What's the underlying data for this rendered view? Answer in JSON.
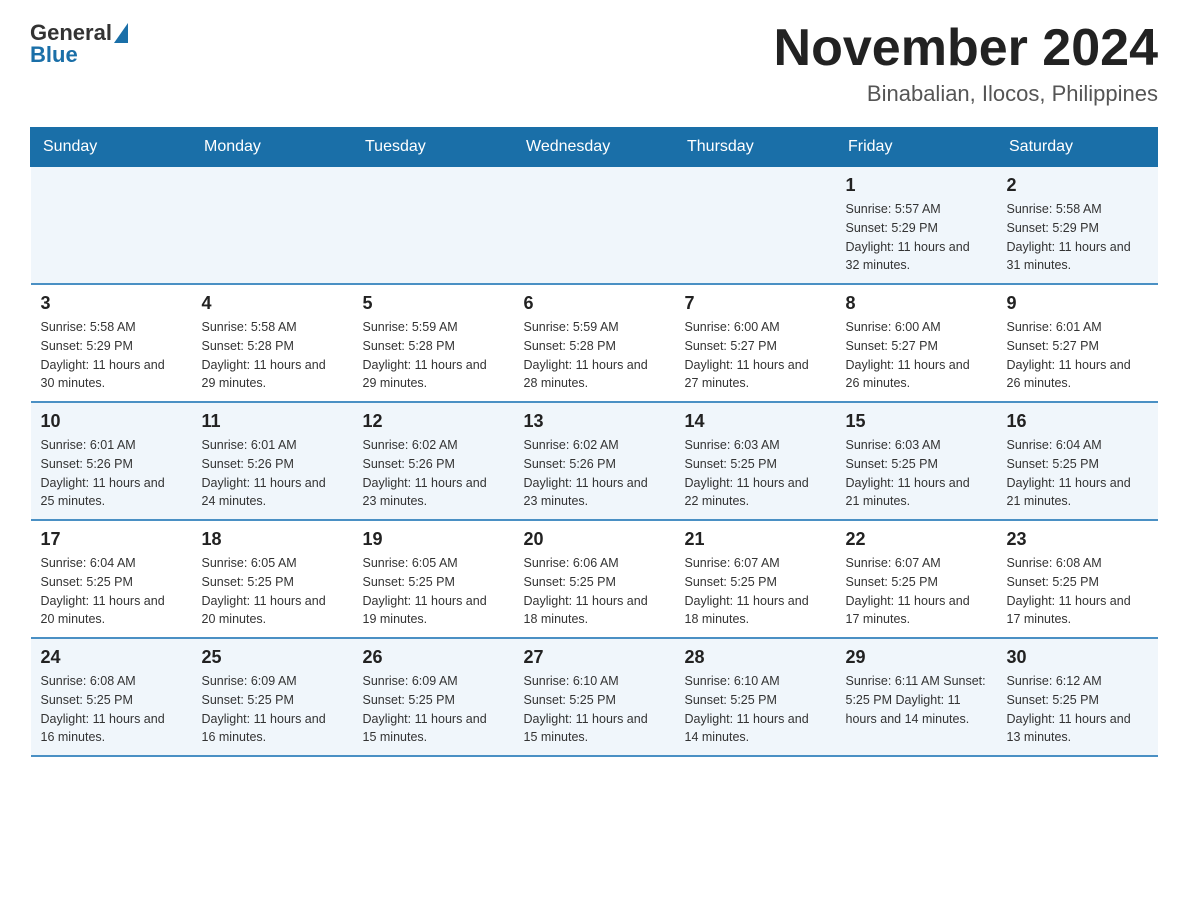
{
  "header": {
    "logo": {
      "text_general": "General",
      "text_blue": "Blue"
    },
    "title": "November 2024",
    "subtitle": "Binabalian, Ilocos, Philippines"
  },
  "weekdays": [
    "Sunday",
    "Monday",
    "Tuesday",
    "Wednesday",
    "Thursday",
    "Friday",
    "Saturday"
  ],
  "rows": [
    {
      "cells": [
        {
          "day": "",
          "info": ""
        },
        {
          "day": "",
          "info": ""
        },
        {
          "day": "",
          "info": ""
        },
        {
          "day": "",
          "info": ""
        },
        {
          "day": "",
          "info": ""
        },
        {
          "day": "1",
          "info": "Sunrise: 5:57 AM\nSunset: 5:29 PM\nDaylight: 11 hours and 32 minutes."
        },
        {
          "day": "2",
          "info": "Sunrise: 5:58 AM\nSunset: 5:29 PM\nDaylight: 11 hours and 31 minutes."
        }
      ]
    },
    {
      "cells": [
        {
          "day": "3",
          "info": "Sunrise: 5:58 AM\nSunset: 5:29 PM\nDaylight: 11 hours and 30 minutes."
        },
        {
          "day": "4",
          "info": "Sunrise: 5:58 AM\nSunset: 5:28 PM\nDaylight: 11 hours and 29 minutes."
        },
        {
          "day": "5",
          "info": "Sunrise: 5:59 AM\nSunset: 5:28 PM\nDaylight: 11 hours and 29 minutes."
        },
        {
          "day": "6",
          "info": "Sunrise: 5:59 AM\nSunset: 5:28 PM\nDaylight: 11 hours and 28 minutes."
        },
        {
          "day": "7",
          "info": "Sunrise: 6:00 AM\nSunset: 5:27 PM\nDaylight: 11 hours and 27 minutes."
        },
        {
          "day": "8",
          "info": "Sunrise: 6:00 AM\nSunset: 5:27 PM\nDaylight: 11 hours and 26 minutes."
        },
        {
          "day": "9",
          "info": "Sunrise: 6:01 AM\nSunset: 5:27 PM\nDaylight: 11 hours and 26 minutes."
        }
      ]
    },
    {
      "cells": [
        {
          "day": "10",
          "info": "Sunrise: 6:01 AM\nSunset: 5:26 PM\nDaylight: 11 hours and 25 minutes."
        },
        {
          "day": "11",
          "info": "Sunrise: 6:01 AM\nSunset: 5:26 PM\nDaylight: 11 hours and 24 minutes."
        },
        {
          "day": "12",
          "info": "Sunrise: 6:02 AM\nSunset: 5:26 PM\nDaylight: 11 hours and 23 minutes."
        },
        {
          "day": "13",
          "info": "Sunrise: 6:02 AM\nSunset: 5:26 PM\nDaylight: 11 hours and 23 minutes."
        },
        {
          "day": "14",
          "info": "Sunrise: 6:03 AM\nSunset: 5:25 PM\nDaylight: 11 hours and 22 minutes."
        },
        {
          "day": "15",
          "info": "Sunrise: 6:03 AM\nSunset: 5:25 PM\nDaylight: 11 hours and 21 minutes."
        },
        {
          "day": "16",
          "info": "Sunrise: 6:04 AM\nSunset: 5:25 PM\nDaylight: 11 hours and 21 minutes."
        }
      ]
    },
    {
      "cells": [
        {
          "day": "17",
          "info": "Sunrise: 6:04 AM\nSunset: 5:25 PM\nDaylight: 11 hours and 20 minutes."
        },
        {
          "day": "18",
          "info": "Sunrise: 6:05 AM\nSunset: 5:25 PM\nDaylight: 11 hours and 20 minutes."
        },
        {
          "day": "19",
          "info": "Sunrise: 6:05 AM\nSunset: 5:25 PM\nDaylight: 11 hours and 19 minutes."
        },
        {
          "day": "20",
          "info": "Sunrise: 6:06 AM\nSunset: 5:25 PM\nDaylight: 11 hours and 18 minutes."
        },
        {
          "day": "21",
          "info": "Sunrise: 6:07 AM\nSunset: 5:25 PM\nDaylight: 11 hours and 18 minutes."
        },
        {
          "day": "22",
          "info": "Sunrise: 6:07 AM\nSunset: 5:25 PM\nDaylight: 11 hours and 17 minutes."
        },
        {
          "day": "23",
          "info": "Sunrise: 6:08 AM\nSunset: 5:25 PM\nDaylight: 11 hours and 17 minutes."
        }
      ]
    },
    {
      "cells": [
        {
          "day": "24",
          "info": "Sunrise: 6:08 AM\nSunset: 5:25 PM\nDaylight: 11 hours and 16 minutes."
        },
        {
          "day": "25",
          "info": "Sunrise: 6:09 AM\nSunset: 5:25 PM\nDaylight: 11 hours and 16 minutes."
        },
        {
          "day": "26",
          "info": "Sunrise: 6:09 AM\nSunset: 5:25 PM\nDaylight: 11 hours and 15 minutes."
        },
        {
          "day": "27",
          "info": "Sunrise: 6:10 AM\nSunset: 5:25 PM\nDaylight: 11 hours and 15 minutes."
        },
        {
          "day": "28",
          "info": "Sunrise: 6:10 AM\nSunset: 5:25 PM\nDaylight: 11 hours and 14 minutes."
        },
        {
          "day": "29",
          "info": "Sunrise: 6:11 AM\nSunset: 5:25 PM\nDaylight: 11 hours and 14 minutes."
        },
        {
          "day": "30",
          "info": "Sunrise: 6:12 AM\nSunset: 5:25 PM\nDaylight: 11 hours and 13 minutes."
        }
      ]
    }
  ]
}
